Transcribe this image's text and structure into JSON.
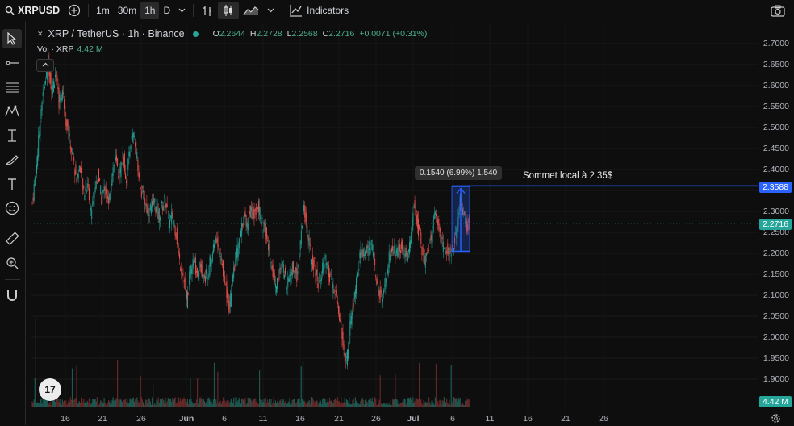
{
  "toolbar": {
    "symbol": "XRPUSD",
    "intervals": [
      "1m",
      "30m",
      "1h",
      "D"
    ],
    "active_interval": "1h",
    "indicators_label": "Indicators"
  },
  "legend": {
    "pair": "XRP / TetherUS · 1h · Binance",
    "o_label": "O",
    "o_value": "2.2644",
    "h_label": "H",
    "h_value": "2.2728",
    "l_label": "L",
    "l_value": "2.2568",
    "c_label": "C",
    "c_value": "2.2716",
    "change": "+0.0071 (+0.31%)",
    "vol_label": "Vol · XRP",
    "vol_value": "4.42 M"
  },
  "y_axis": {
    "ticks": [
      "2.7000",
      "2.6500",
      "2.6000",
      "2.5500",
      "2.5000",
      "2.4500",
      "2.4000",
      "2.3500",
      "2.3000",
      "2.2500",
      "2.2000",
      "2.1500",
      "2.1000",
      "2.0500",
      "2.0000",
      "1.9500",
      "1.9000"
    ],
    "current_price": "2.2716",
    "marker_price": "2.3588",
    "volume_tag": "4.42 M"
  },
  "x_axis": {
    "ticks": [
      "16",
      "21",
      "26",
      "Jun",
      "6",
      "11",
      "16",
      "21",
      "26",
      "Jul",
      "6",
      "11",
      "16",
      "21",
      "26"
    ]
  },
  "annotations": {
    "measure": "0.1540 (6.99%) 1,540",
    "label": "Sommet local à 2.35$"
  },
  "colors": {
    "up": "#26a69a",
    "down": "#ef5350",
    "accent": "#2962ff",
    "current_price_bg": "#26a69a"
  },
  "chart_data": {
    "type": "candlestick",
    "ylim": [
      1.87,
      2.72
    ],
    "path_points": [
      [
        0,
        2.32
      ],
      [
        3,
        2.44
      ],
      [
        5,
        2.55
      ],
      [
        7,
        2.6
      ],
      [
        9,
        2.66
      ],
      [
        11,
        2.58
      ],
      [
        13,
        2.63
      ],
      [
        15,
        2.56
      ],
      [
        17,
        2.59
      ],
      [
        19,
        2.52
      ],
      [
        21,
        2.47
      ],
      [
        23,
        2.42
      ],
      [
        25,
        2.38
      ],
      [
        27,
        2.41
      ],
      [
        29,
        2.34
      ],
      [
        31,
        2.37
      ],
      [
        33,
        2.3
      ],
      [
        35,
        2.35
      ],
      [
        37,
        2.39
      ],
      [
        39,
        2.33
      ],
      [
        41,
        2.36
      ],
      [
        43,
        2.31
      ],
      [
        45,
        2.4
      ],
      [
        47,
        2.42
      ],
      [
        49,
        2.38
      ],
      [
        51,
        2.44
      ],
      [
        53,
        2.37
      ],
      [
        55,
        2.46
      ],
      [
        57,
        2.48
      ],
      [
        59,
        2.43
      ],
      [
        61,
        2.35
      ],
      [
        63,
        2.33
      ],
      [
        65,
        2.3
      ],
      [
        67,
        2.31
      ],
      [
        69,
        2.32
      ],
      [
        71,
        2.29
      ],
      [
        73,
        2.31
      ],
      [
        75,
        2.33
      ],
      [
        77,
        2.27
      ],
      [
        79,
        2.29
      ],
      [
        81,
        2.25
      ],
      [
        83,
        2.18
      ],
      [
        85,
        2.15
      ],
      [
        87,
        2.08
      ],
      [
        89,
        2.16
      ],
      [
        91,
        2.18
      ],
      [
        93,
        2.15
      ],
      [
        95,
        2.17
      ],
      [
        97,
        2.14
      ],
      [
        99,
        2.16
      ],
      [
        101,
        2.19
      ],
      [
        103,
        2.24
      ],
      [
        105,
        2.21
      ],
      [
        107,
        2.17
      ],
      [
        109,
        2.12
      ],
      [
        111,
        2.07
      ],
      [
        113,
        2.15
      ],
      [
        115,
        2.2
      ],
      [
        117,
        2.23
      ],
      [
        119,
        2.29
      ],
      [
        121,
        2.27
      ],
      [
        123,
        2.31
      ],
      [
        125,
        2.29
      ],
      [
        127,
        2.32
      ],
      [
        129,
        2.27
      ],
      [
        131,
        2.26
      ],
      [
        133,
        2.21
      ],
      [
        135,
        2.17
      ],
      [
        137,
        2.12
      ],
      [
        139,
        2.15
      ],
      [
        141,
        2.17
      ],
      [
        143,
        2.13
      ],
      [
        145,
        2.15
      ],
      [
        147,
        2.17
      ],
      [
        149,
        2.14
      ],
      [
        151,
        2.23
      ],
      [
        153,
        2.31
      ],
      [
        155,
        2.25
      ],
      [
        157,
        2.19
      ],
      [
        159,
        2.17
      ],
      [
        161,
        2.13
      ],
      [
        163,
        2.16
      ],
      [
        165,
        2.18
      ],
      [
        167,
        2.15
      ],
      [
        169,
        2.12
      ],
      [
        171,
        2.1
      ],
      [
        173,
        2.05
      ],
      [
        175,
        1.98
      ],
      [
        177,
        1.94
      ],
      [
        179,
        2.03
      ],
      [
        181,
        2.08
      ],
      [
        183,
        2.15
      ],
      [
        185,
        2.2
      ],
      [
        187,
        2.19
      ],
      [
        189,
        2.21
      ],
      [
        191,
        2.22
      ],
      [
        193,
        2.16
      ],
      [
        195,
        2.11
      ],
      [
        197,
        2.08
      ],
      [
        199,
        2.13
      ],
      [
        201,
        2.19
      ],
      [
        203,
        2.21
      ],
      [
        205,
        2.2
      ],
      [
        207,
        2.22
      ],
      [
        209,
        2.21
      ],
      [
        211,
        2.19
      ],
      [
        213,
        2.23
      ],
      [
        215,
        2.32
      ],
      [
        217,
        2.27
      ],
      [
        219,
        2.22
      ],
      [
        221,
        2.18
      ],
      [
        223,
        2.21
      ],
      [
        225,
        2.25
      ],
      [
        227,
        2.3
      ],
      [
        229,
        2.26
      ],
      [
        231,
        2.22
      ],
      [
        233,
        2.21
      ],
      [
        235,
        2.2
      ],
      [
        237,
        2.22
      ],
      [
        239,
        2.25
      ],
      [
        241,
        2.33
      ],
      [
        243,
        2.29
      ],
      [
        245,
        2.26
      ],
      [
        247,
        2.28
      ]
    ]
  }
}
